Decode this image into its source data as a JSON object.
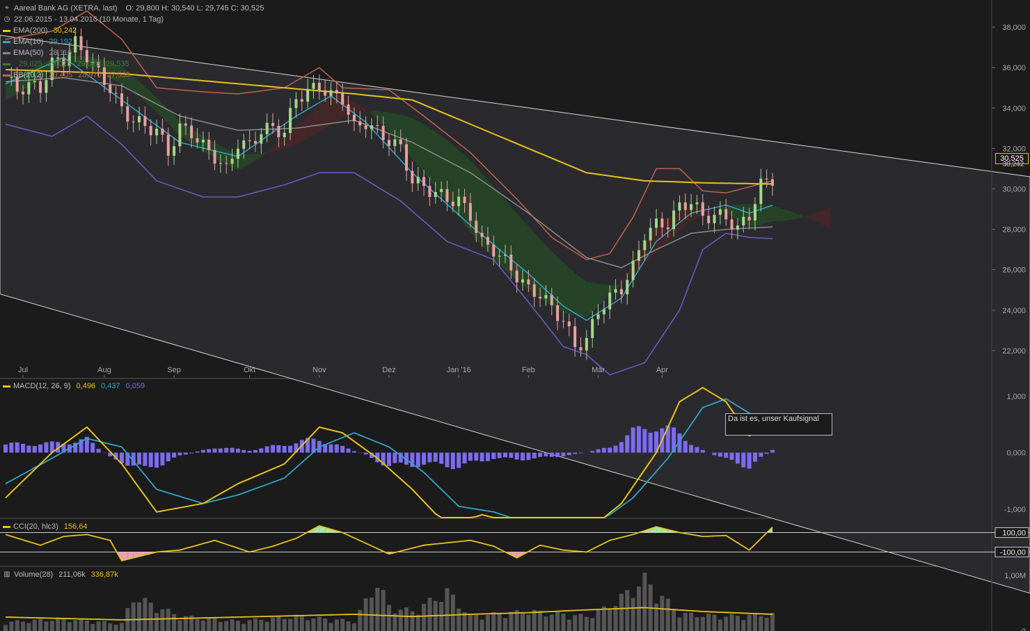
{
  "header": {
    "title": "Aareal Bank AG (XETRA, last)",
    "ohlc": "O: 29,800  H: 30,540  L: 29,745  C: 30,525",
    "range": "22.06.2015 - 13.04.2016 (10 Monate, 1 Tag)"
  },
  "legend_main": [
    {
      "label": "EMA(200)",
      "values": [
        "30,242"
      ],
      "color": "#e8c21a"
    },
    {
      "label": "EMA(10)",
      "values": [
        "29,192"
      ],
      "color": "#2fa6c6"
    },
    {
      "label": "EMA(50)",
      "values": [
        "28,116"
      ],
      "color": "#8a8a8a"
    },
    {
      "label": "",
      "values": [
        "29,025",
        "29,025",
        "29,025",
        "29,535"
      ],
      "color": "#3e7a3e"
    },
    {
      "label": "BB(20,2)",
      "values": [
        "30,405",
        "28,970",
        "27,535"
      ],
      "color": "#c0624a"
    }
  ],
  "legend_macd": {
    "label": "MACD(12, 26, 9)",
    "values": [
      "0,496",
      "0,437",
      "0,059"
    ],
    "colors": [
      "#e8c21a",
      "#2fa6c6",
      "#7b6cf0"
    ]
  },
  "legend_cci": {
    "label": "CCI(20, hlc3)",
    "value": "156,64",
    "color": "#e8c21a"
  },
  "legend_volume": {
    "label": "Volume(28)",
    "value1": "211,06k",
    "value2": "336,87k"
  },
  "annotation": "Da ist es, unser Kaufsignal",
  "price_badge": "30,525",
  "price_badge_secondary": "30,242",
  "colors": {
    "background": "#1b1b1b",
    "channel": "#2a2a2e",
    "up_candle": "#a6d68a",
    "down_candle": "#e8a0a0",
    "ema200": "#e8c21a",
    "ema10": "#2fa6c6",
    "ema50": "#8a8a8a",
    "bb_upper": "#c0624a",
    "bb_lower": "#6b5bc9",
    "cloud_green": "#264a26",
    "cloud_red": "#4a2626",
    "macd": "#e8c21a",
    "signal": "#2fa6c6",
    "hist": "#7b6cf0",
    "cci": "#e8c21a",
    "volume": "#555555",
    "volume_ma": "#e8c21a"
  },
  "chart_data": [
    {
      "type": "candlestick",
      "title": "Aareal Bank AG (XETRA, last)",
      "x_labels": [
        "Jul",
        "Aug",
        "Sep",
        "Okt",
        "Nov",
        "Dez",
        "Jan '16",
        "Feb",
        "Mär",
        "Apr"
      ],
      "y_ticks": [
        "38,000",
        "36,000",
        "34,000",
        "32,000",
        "30,000",
        "28,000",
        "26,000",
        "24,000",
        "22,000"
      ],
      "y_tick_values": [
        38,
        36,
        34,
        32,
        30,
        28,
        26,
        24,
        22
      ],
      "ylim": [
        21.0,
        39.0
      ],
      "close_path": [
        [
          0,
          35.5
        ],
        [
          2,
          34.9
        ],
        [
          4,
          35.1
        ],
        [
          6,
          35.0
        ],
        [
          8,
          36.2
        ],
        [
          10,
          36.4
        ],
        [
          12,
          37.2
        ],
        [
          14,
          36.6
        ],
        [
          16,
          35.7
        ],
        [
          18,
          35.0
        ],
        [
          20,
          33.9
        ],
        [
          22,
          33.4
        ],
        [
          24,
          33.1
        ],
        [
          26,
          32.9
        ],
        [
          28,
          31.8
        ],
        [
          30,
          33.0
        ],
        [
          32,
          32.8
        ],
        [
          34,
          32.1
        ],
        [
          36,
          31.6
        ],
        [
          38,
          30.9
        ],
        [
          40,
          32.3
        ],
        [
          42,
          32.1
        ],
        [
          44,
          32.9
        ],
        [
          46,
          33.0
        ],
        [
          48,
          32.8
        ],
        [
          50,
          34.5
        ],
        [
          52,
          34.8
        ],
        [
          54,
          35.1
        ],
        [
          56,
          34.6
        ],
        [
          58,
          34.5
        ],
        [
          60,
          33.0
        ],
        [
          62,
          33.3
        ],
        [
          64,
          32.8
        ],
        [
          66,
          32.4
        ],
        [
          68,
          32.0
        ],
        [
          70,
          30.4
        ],
        [
          72,
          30.1
        ],
        [
          74,
          29.8
        ],
        [
          76,
          29.5
        ],
        [
          78,
          29.4
        ],
        [
          80,
          28.7
        ],
        [
          82,
          27.3
        ],
        [
          84,
          27.0
        ],
        [
          86,
          26.4
        ],
        [
          88,
          25.7
        ],
        [
          90,
          25.0
        ],
        [
          92,
          24.8
        ],
        [
          94,
          24.1
        ],
        [
          96,
          23.5
        ],
        [
          98,
          22.2
        ],
        [
          100,
          22.5
        ],
        [
          102,
          24.0
        ],
        [
          104,
          24.6
        ],
        [
          106,
          25.1
        ],
        [
          108,
          26.1
        ],
        [
          110,
          27.8
        ],
        [
          112,
          28.2
        ],
        [
          114,
          28.3
        ],
        [
          116,
          29.1
        ],
        [
          118,
          29.4
        ],
        [
          120,
          28.6
        ],
        [
          122,
          28.7
        ],
        [
          124,
          28.6
        ],
        [
          126,
          28.0
        ],
        [
          128,
          28.7
        ],
        [
          130,
          30.2
        ],
        [
          132,
          30.5
        ]
      ],
      "ema200_path": [
        [
          0,
          35.9
        ],
        [
          20,
          35.7
        ],
        [
          40,
          35.2
        ],
        [
          60,
          34.7
        ],
        [
          70,
          34.4
        ],
        [
          80,
          33.2
        ],
        [
          90,
          32.0
        ],
        [
          100,
          30.8
        ],
        [
          110,
          30.4
        ],
        [
          120,
          30.3
        ],
        [
          132,
          30.24
        ]
      ],
      "ema10_path": [
        [
          0,
          35.2
        ],
        [
          10,
          36.5
        ],
        [
          20,
          34.4
        ],
        [
          30,
          32.3
        ],
        [
          40,
          31.6
        ],
        [
          50,
          33.6
        ],
        [
          56,
          34.6
        ],
        [
          62,
          33.3
        ],
        [
          70,
          30.8
        ],
        [
          80,
          28.2
        ],
        [
          90,
          25.8
        ],
        [
          96,
          24.2
        ],
        [
          100,
          23.5
        ],
        [
          106,
          24.6
        ],
        [
          112,
          27.4
        ],
        [
          118,
          28.8
        ],
        [
          124,
          29.2
        ],
        [
          128,
          28.8
        ],
        [
          132,
          29.19
        ]
      ],
      "ema50_path": [
        [
          0,
          35.3
        ],
        [
          10,
          35.5
        ],
        [
          20,
          35.1
        ],
        [
          30,
          33.6
        ],
        [
          40,
          32.9
        ],
        [
          50,
          33.0
        ],
        [
          60,
          33.4
        ],
        [
          70,
          32.3
        ],
        [
          80,
          30.8
        ],
        [
          90,
          28.8
        ],
        [
          100,
          26.6
        ],
        [
          106,
          26.1
        ],
        [
          112,
          27.0
        ],
        [
          118,
          27.8
        ],
        [
          124,
          28.0
        ],
        [
          132,
          28.12
        ]
      ],
      "bb_upper_path": [
        [
          0,
          37.4
        ],
        [
          8,
          37.8
        ],
        [
          14,
          38.8
        ],
        [
          20,
          37.4
        ],
        [
          26,
          35.0
        ],
        [
          34,
          34.8
        ],
        [
          40,
          34.7
        ],
        [
          48,
          35.0
        ],
        [
          54,
          36.0
        ],
        [
          58,
          35.0
        ],
        [
          66,
          34.9
        ],
        [
          72,
          33.6
        ],
        [
          80,
          31.8
        ],
        [
          88,
          29.5
        ],
        [
          94,
          27.6
        ],
        [
          100,
          26.5
        ],
        [
          104,
          26.8
        ],
        [
          108,
          28.6
        ],
        [
          112,
          31.0
        ],
        [
          116,
          31.0
        ],
        [
          120,
          29.9
        ],
        [
          124,
          29.8
        ],
        [
          132,
          30.4
        ]
      ],
      "bb_lower_path": [
        [
          0,
          33.2
        ],
        [
          8,
          32.6
        ],
        [
          14,
          33.6
        ],
        [
          20,
          32.2
        ],
        [
          26,
          30.4
        ],
        [
          34,
          29.6
        ],
        [
          40,
          29.6
        ],
        [
          48,
          30.2
        ],
        [
          54,
          30.8
        ],
        [
          60,
          30.8
        ],
        [
          68,
          29.4
        ],
        [
          76,
          27.4
        ],
        [
          84,
          26.5
        ],
        [
          90,
          24.4
        ],
        [
          96,
          22.2
        ],
        [
          100,
          21.8
        ],
        [
          104,
          20.8
        ],
        [
          110,
          21.4
        ],
        [
          116,
          24.0
        ],
        [
          120,
          27.0
        ],
        [
          124,
          27.8
        ],
        [
          128,
          27.6
        ],
        [
          132,
          27.54
        ]
      ]
    },
    {
      "type": "line",
      "title": "MACD(12, 26, 9)",
      "y_ticks": [
        "1,000",
        "0,000",
        "-1,000"
      ],
      "y_tick_values": [
        1,
        0,
        -1
      ],
      "ylim": [
        -1.15,
        1.3
      ],
      "macd_path": [
        [
          0,
          -0.8
        ],
        [
          8,
          0.0
        ],
        [
          14,
          0.45
        ],
        [
          20,
          -0.2
        ],
        [
          26,
          -1.05
        ],
        [
          34,
          -0.9
        ],
        [
          40,
          -0.55
        ],
        [
          48,
          -0.2
        ],
        [
          54,
          0.45
        ],
        [
          58,
          0.35
        ],
        [
          64,
          -0.1
        ],
        [
          70,
          -0.65
        ],
        [
          76,
          -1.3
        ],
        [
          82,
          -1.1
        ],
        [
          88,
          -1.25
        ],
        [
          94,
          -1.15
        ],
        [
          100,
          -1.4
        ],
        [
          106,
          -0.9
        ],
        [
          112,
          0.0
        ],
        [
          116,
          0.9
        ],
        [
          120,
          1.15
        ],
        [
          124,
          0.9
        ],
        [
          128,
          0.3
        ],
        [
          132,
          0.496
        ]
      ],
      "signal_path": [
        [
          0,
          -0.55
        ],
        [
          8,
          -0.1
        ],
        [
          14,
          0.25
        ],
        [
          20,
          0.1
        ],
        [
          26,
          -0.65
        ],
        [
          34,
          -0.9
        ],
        [
          40,
          -0.75
        ],
        [
          48,
          -0.45
        ],
        [
          54,
          0.1
        ],
        [
          60,
          0.35
        ],
        [
          66,
          0.1
        ],
        [
          72,
          -0.35
        ],
        [
          78,
          -0.95
        ],
        [
          84,
          -1.05
        ],
        [
          90,
          -1.25
        ],
        [
          96,
          -1.3
        ],
        [
          102,
          -1.25
        ],
        [
          108,
          -0.8
        ],
        [
          114,
          -0.1
        ],
        [
          120,
          0.8
        ],
        [
          124,
          0.95
        ],
        [
          128,
          0.7
        ],
        [
          132,
          0.437
        ]
      ],
      "hist_path": [
        [
          0,
          0.18
        ],
        [
          8,
          0.2
        ],
        [
          14,
          0.28
        ],
        [
          18,
          -0.1
        ],
        [
          24,
          -0.38
        ],
        [
          30,
          -0.08
        ],
        [
          36,
          0.12
        ],
        [
          42,
          0.05
        ],
        [
          48,
          0.18
        ],
        [
          54,
          0.3
        ],
        [
          58,
          0.12
        ],
        [
          62,
          -0.05
        ],
        [
          66,
          -0.3
        ],
        [
          72,
          -0.25
        ],
        [
          78,
          -0.3
        ],
        [
          84,
          -0.12
        ],
        [
          88,
          -0.15
        ],
        [
          94,
          -0.1
        ],
        [
          100,
          0.0
        ],
        [
          104,
          0.12
        ],
        [
          108,
          0.45
        ],
        [
          112,
          0.6
        ],
        [
          116,
          0.4
        ],
        [
          120,
          0.05
        ],
        [
          124,
          -0.15
        ],
        [
          128,
          -0.3
        ],
        [
          132,
          0.059
        ]
      ]
    },
    {
      "type": "line",
      "title": "CCI(20, hlc3)",
      "y_ticks": [
        "100,00",
        "-100,00"
      ],
      "y_tick_values": [
        100,
        -100
      ],
      "ylim": [
        -240,
        240
      ],
      "cci_path": [
        [
          0,
          80
        ],
        [
          6,
          -30
        ],
        [
          10,
          60
        ],
        [
          14,
          80
        ],
        [
          18,
          20
        ],
        [
          20,
          -190
        ],
        [
          26,
          -100
        ],
        [
          30,
          -80
        ],
        [
          36,
          20
        ],
        [
          42,
          -100
        ],
        [
          46,
          -40
        ],
        [
          50,
          40
        ],
        [
          54,
          170
        ],
        [
          58,
          100
        ],
        [
          62,
          -10
        ],
        [
          66,
          -120
        ],
        [
          72,
          -30
        ],
        [
          80,
          20
        ],
        [
          84,
          -40
        ],
        [
          88,
          -160
        ],
        [
          92,
          -30
        ],
        [
          96,
          -80
        ],
        [
          100,
          -100
        ],
        [
          104,
          20
        ],
        [
          108,
          80
        ],
        [
          112,
          160
        ],
        [
          116,
          100
        ],
        [
          120,
          60
        ],
        [
          124,
          70
        ],
        [
          128,
          -80
        ],
        [
          132,
          156.64
        ]
      ]
    },
    {
      "type": "bar",
      "title": "Volume(28)",
      "y_ticks": [
        "1,00M",
        "0"
      ],
      "y_tick_values": [
        1,
        0
      ],
      "ylim": [
        0,
        1.15
      ],
      "volume_ma_value": "211,06k",
      "volume_value": "336,87k",
      "volume_path": [
        [
          0,
          0.18
        ],
        [
          10,
          0.25
        ],
        [
          20,
          0.15
        ],
        [
          22,
          0.7
        ],
        [
          30,
          0.3
        ],
        [
          40,
          0.2
        ],
        [
          50,
          0.3
        ],
        [
          60,
          0.2
        ],
        [
          64,
          1.0
        ],
        [
          66,
          0.5
        ],
        [
          70,
          0.4
        ],
        [
          76,
          0.8
        ],
        [
          80,
          0.3
        ],
        [
          90,
          0.4
        ],
        [
          100,
          0.3
        ],
        [
          104,
          0.5
        ],
        [
          110,
          1.05
        ],
        [
          116,
          0.35
        ],
        [
          124,
          0.3
        ],
        [
          132,
          0.34
        ]
      ],
      "volume_ma_path": [
        [
          0,
          0.25
        ],
        [
          20,
          0.2
        ],
        [
          40,
          0.25
        ],
        [
          60,
          0.3
        ],
        [
          70,
          0.26
        ],
        [
          80,
          0.3
        ],
        [
          90,
          0.33
        ],
        [
          100,
          0.38
        ],
        [
          110,
          0.42
        ],
        [
          120,
          0.35
        ],
        [
          132,
          0.3
        ]
      ]
    }
  ]
}
